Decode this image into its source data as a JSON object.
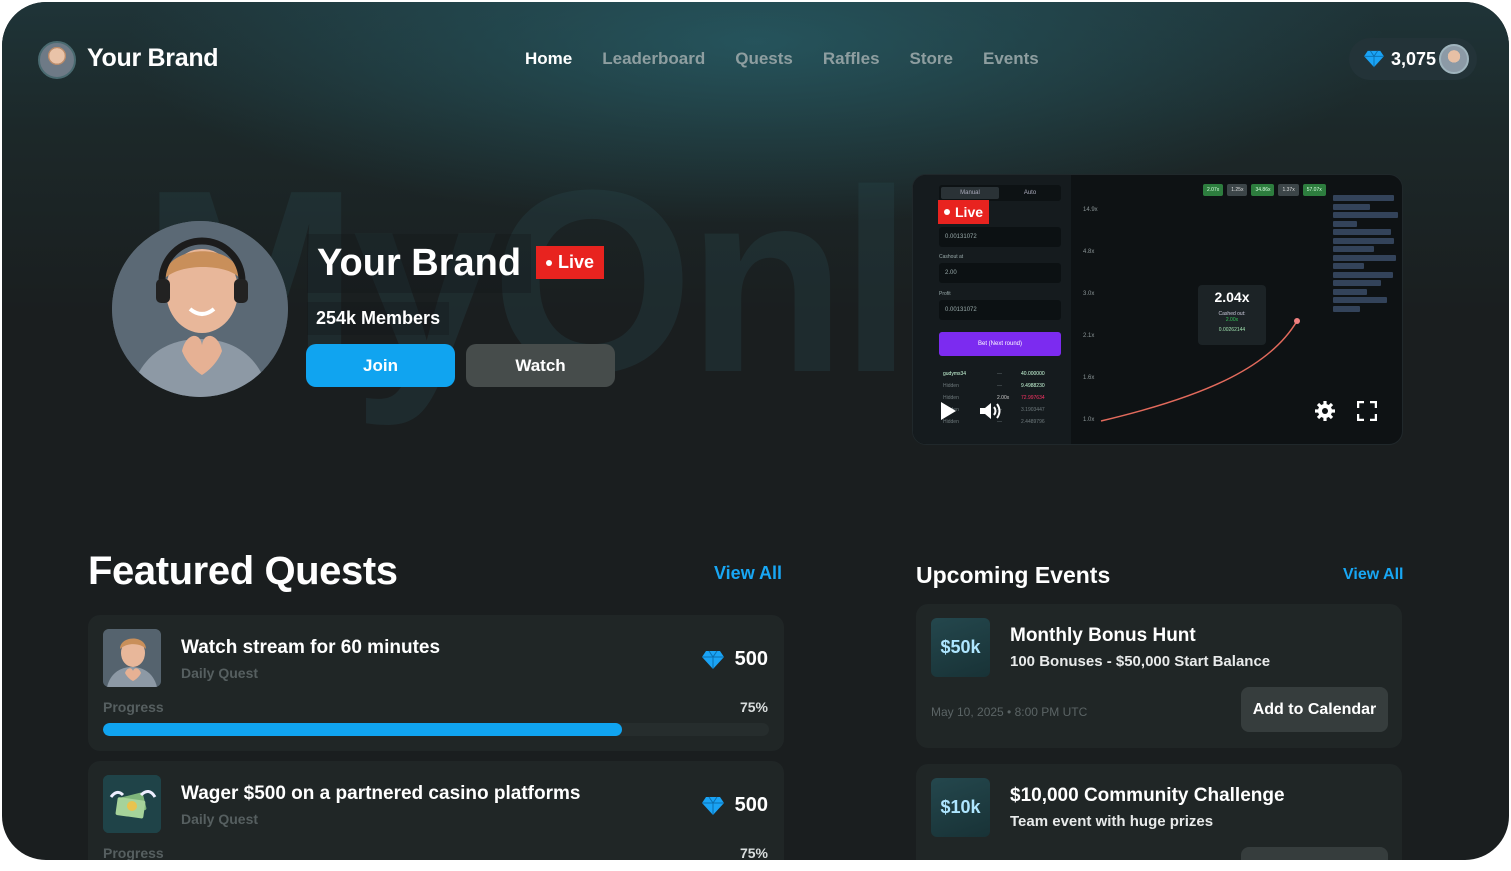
{
  "header": {
    "brand_name": "Your Brand",
    "nav": [
      "Home",
      "Leaderboard",
      "Quests",
      "Raffles",
      "Store",
      "Events"
    ],
    "active_nav": "Home",
    "balance": "3,075"
  },
  "hero": {
    "watermark_text": "MyOnl",
    "title": "Your Brand",
    "live_label": "Live",
    "members": "254k Members",
    "join_label": "Join",
    "watch_label": "Watch"
  },
  "player": {
    "live_label": "Live",
    "multiplier": "2.04x",
    "cashed_out_label": "Cashed out:",
    "cashed_out_value": "2.00x",
    "cashed_out_amount": "0.00262144",
    "tabs": [
      "Manual",
      "Auto"
    ],
    "amount_value": "0.00131072",
    "cashout_label": "Cashout at",
    "cashout_value": "2.00",
    "profit_label": "Profit",
    "profit_value": "0.00131072",
    "bet_label": "Bet (Next round)",
    "recent_multipliers": [
      "2.07x",
      "1.25x",
      "34.86x",
      "1.37x",
      "57.07x"
    ],
    "y_ticks": [
      "14.9x",
      "4.8x",
      "3.0x",
      "2.1x",
      "1.6x",
      "1.0x"
    ],
    "bets": [
      {
        "user": "gudyms34",
        "mult": "—",
        "amount": "40.000000"
      },
      {
        "user": "Hidden",
        "mult": "—",
        "amount": "9.4988230"
      },
      {
        "user": "Hidden",
        "mult": "2.00x",
        "amount": "72.997634"
      },
      {
        "user": "Hidden",
        "mult": "—",
        "amount": "3.1903447"
      },
      {
        "user": "Hidden",
        "mult": "—",
        "amount": "2.4489796"
      }
    ]
  },
  "featured_quests": {
    "title": "Featured Quests",
    "view_all": "View All",
    "items": [
      {
        "title": "Watch stream for 60 minutes",
        "subtitle": "Daily Quest",
        "reward": "500",
        "progress_label": "Progress",
        "progress_text": "75%",
        "progress_value": 0.78
      },
      {
        "title": "Wager $500 on a partnered casino platforms",
        "subtitle": "Daily Quest",
        "reward": "500",
        "progress_label": "Progress",
        "progress_text": "75%",
        "progress_value": 0.75
      }
    ]
  },
  "upcoming_events": {
    "title": "Upcoming Events",
    "view_all": "View All",
    "items": [
      {
        "badge": "$50k",
        "title": "Monthly Bonus Hunt",
        "subtitle": "100 Bonuses - $50,000 Start Balance",
        "date": "May 10, 2025 • 8:00 PM UTC",
        "button": "Add to Calendar"
      },
      {
        "badge": "$10k",
        "title": "$10,000 Community Challenge",
        "subtitle": "Team event with huge prizes",
        "date": "",
        "button": ""
      }
    ]
  },
  "colors": {
    "accent": "#10a4f0",
    "live": "#e8231f",
    "background": "#1a1e1f",
    "card": "#202626"
  },
  "icons": [
    "diamond-icon",
    "play-icon",
    "volume-icon",
    "gear-icon",
    "fullscreen-icon"
  ]
}
